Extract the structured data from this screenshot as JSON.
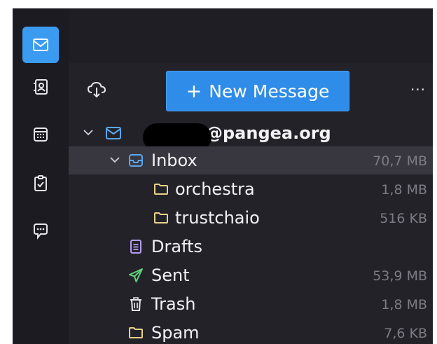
{
  "toolbar": {
    "new_message_label": "New Message",
    "new_message_plus": "+",
    "more_label": "···"
  },
  "account": {
    "email_suffix": "@pangea.org"
  },
  "folders": [
    {
      "name": "Inbox",
      "size": "70,7 MB"
    },
    {
      "name": "orchestra",
      "size": "1,8 MB"
    },
    {
      "name": "trustchaio",
      "size": "516 KB"
    },
    {
      "name": "Drafts",
      "size": ""
    },
    {
      "name": "Sent",
      "size": "53,9 MB"
    },
    {
      "name": "Trash",
      "size": "1,8 MB"
    },
    {
      "name": "Spam",
      "size": "7,6 KB"
    }
  ],
  "colors": {
    "accent": "#2f8ce8",
    "folder_yellow": "#e8d28a",
    "drafts_purple": "#b59cf0",
    "sent_green": "#5ed17a",
    "inbox_blue": "#5aa8f0"
  },
  "rail_icons": [
    "mail-icon",
    "address-book-icon",
    "calendar-icon",
    "tasks-icon",
    "chat-icon"
  ]
}
